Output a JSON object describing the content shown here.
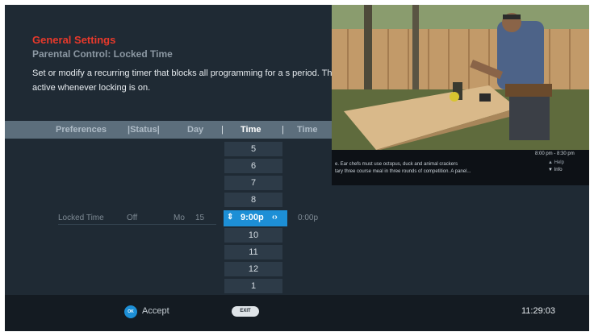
{
  "breadcrumb": {
    "title": "General Settings",
    "subtitle": "Parental Control: Locked Time"
  },
  "description": "Set or modify a recurring timer that blocks all programming for a s period. This timer is active whenever locking is on.",
  "columns": {
    "preferences": "Preferences",
    "status": "|Status|",
    "day": "Day",
    "sep1": "|",
    "time1": "Time",
    "sep2": "|",
    "time2": "Time"
  },
  "picker": {
    "above": [
      "5",
      "6",
      "7",
      "8"
    ],
    "selected": "9:00p",
    "below": [
      "10",
      "11",
      "12",
      "1"
    ]
  },
  "row": {
    "label": "Locked Time",
    "status": "Off",
    "day": "Mo",
    "day_num": "15",
    "end_time": "0:00p"
  },
  "preview": {
    "time": "8:00 pm - 8:30 pm",
    "line1": "e. Ear chefs must use octopus, duck and animal crackers",
    "line2": "tary three course meal in three rounds of competition. A panel...",
    "up_label": "Help",
    "down_label": "Info"
  },
  "footer": {
    "ok": "OK",
    "accept": "Accept",
    "exit": "EXIT",
    "clock": "11:29:03"
  },
  "colors": {
    "accent_red": "#e8392b",
    "selection_blue": "#1d8fd6",
    "background": "#1f2a34"
  }
}
